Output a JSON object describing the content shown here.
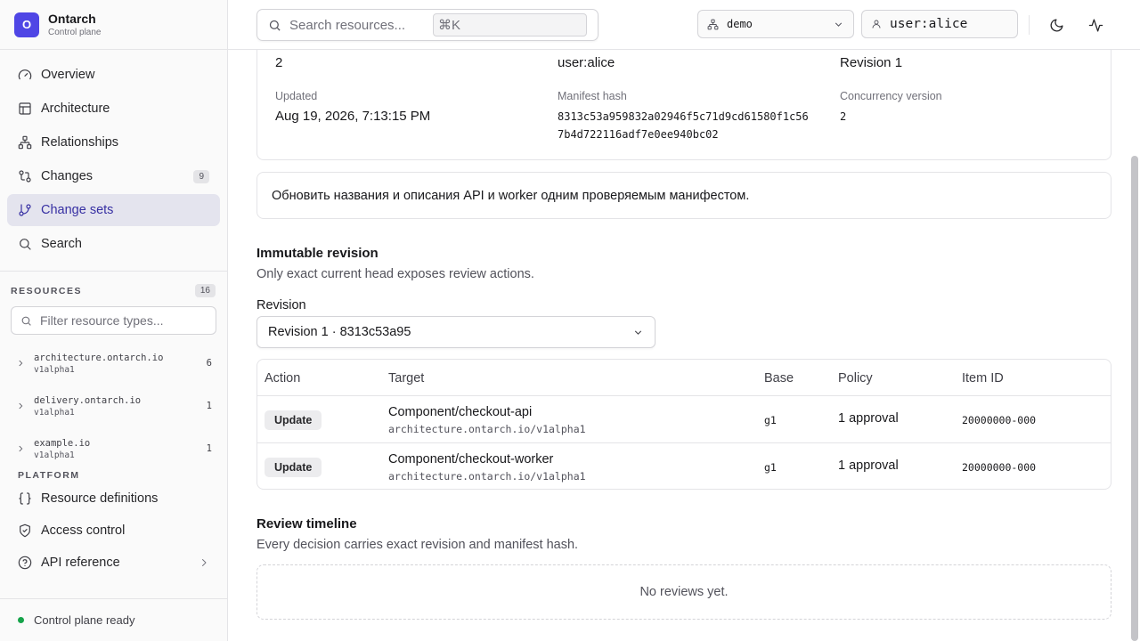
{
  "brand": {
    "logo_letter": "O",
    "title": "Ontarch",
    "subtitle": "Control plane",
    "accent": "#4f46e5"
  },
  "nav": {
    "items": [
      {
        "label": "Overview",
        "icon": "gauge-icon"
      },
      {
        "label": "Architecture",
        "icon": "layout-icon"
      },
      {
        "label": "Relationships",
        "icon": "network-icon"
      },
      {
        "label": "Changes",
        "icon": "git-compare-icon",
        "badge": "9"
      },
      {
        "label": "Change sets",
        "icon": "git-branch-icon",
        "active": true
      },
      {
        "label": "Search",
        "icon": "search-icon"
      }
    ]
  },
  "resources": {
    "label": "RESOURCES",
    "count": "16",
    "filter_placeholder": "Filter resource types...",
    "groups": [
      {
        "name": "architecture.ontarch.io",
        "version": "v1alpha1",
        "count": "6"
      },
      {
        "name": "delivery.ontarch.io",
        "version": "v1alpha1",
        "count": "1"
      },
      {
        "name": "example.io",
        "version": "v1alpha1",
        "count": "1"
      }
    ]
  },
  "platform": {
    "label": "PLATFORM",
    "items": [
      {
        "label": "Resource definitions",
        "icon": "braces-icon"
      },
      {
        "label": "Access control",
        "icon": "shield-check-icon"
      },
      {
        "label": "API reference",
        "icon": "help-circle-icon"
      }
    ]
  },
  "status": {
    "text": "Control plane ready",
    "color": "#16a34a"
  },
  "topbar": {
    "search_placeholder": "Search resources...",
    "shortcut": "⌘K",
    "namespace": "demo",
    "user": "user:alice"
  },
  "meta": {
    "row1": [
      "2",
      "user:alice",
      "Revision 1"
    ],
    "updated_label": "Updated",
    "updated_value": "Aug 19, 2026, 7:13:15 PM",
    "hash_label": "Manifest hash",
    "hash_line1": "8313c53a959832a02946f5c71d9cd61580f1c56",
    "hash_line2": "7b4d722116adf7e0ee940bc02",
    "concurrency_label": "Concurrency version",
    "concurrency_value": "2"
  },
  "description": "Обновить названия и описания API и worker одним проверяемым манифестом.",
  "revision_section": {
    "title": "Immutable revision",
    "subtitle": "Only exact current head exposes review actions.",
    "label": "Revision",
    "selected": "Revision 1 · 8313c53a95"
  },
  "table": {
    "headers": [
      "Action",
      "Target",
      "Base",
      "Policy",
      "Item ID"
    ],
    "rows": [
      {
        "action": "Update",
        "target": "Component/checkout-api",
        "api": "architecture.ontarch.io/v1alpha1",
        "base": "g1",
        "policy": "1 approval",
        "item_id": "20000000-000"
      },
      {
        "action": "Update",
        "target": "Component/checkout-worker",
        "api": "architecture.ontarch.io/v1alpha1",
        "base": "g1",
        "policy": "1 approval",
        "item_id": "20000000-000"
      }
    ]
  },
  "timeline": {
    "title": "Review timeline",
    "subtitle": "Every decision carries exact revision and manifest hash.",
    "empty": "No reviews yet."
  }
}
